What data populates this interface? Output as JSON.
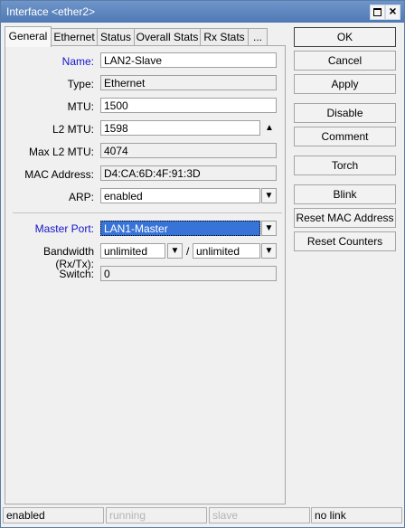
{
  "window": {
    "title": "Interface <ether2>"
  },
  "tabs": [
    "General",
    "Ethernet",
    "Status",
    "Overall Stats",
    "Rx Stats",
    "..."
  ],
  "form": {
    "name": {
      "label": "Name:",
      "value": "LAN2-Slave"
    },
    "type": {
      "label": "Type:",
      "value": "Ethernet"
    },
    "mtu": {
      "label": "MTU:",
      "value": "1500"
    },
    "l2mtu": {
      "label": "L2 MTU:",
      "value": "1598"
    },
    "max_l2mtu": {
      "label": "Max L2 MTU:",
      "value": "4074"
    },
    "mac": {
      "label": "MAC Address:",
      "value": "D4:CA:6D:4F:91:3D"
    },
    "arp": {
      "label": "ARP:",
      "value": "enabled"
    },
    "master_port": {
      "label": "Master Port:",
      "value": "LAN1-Master"
    },
    "bandwidth": {
      "label": "Bandwidth (Rx/Tx):",
      "rx": "unlimited",
      "tx": "unlimited",
      "separator": "/"
    },
    "switch": {
      "label": "Switch:",
      "value": "0"
    }
  },
  "buttons": {
    "ok": "OK",
    "cancel": "Cancel",
    "apply": "Apply",
    "disable": "Disable",
    "comment": "Comment",
    "torch": "Torch",
    "blink": "Blink",
    "reset_mac": "Reset MAC Address",
    "reset_counters": "Reset Counters"
  },
  "statusbar": [
    "enabled",
    "running",
    "slave",
    "no link"
  ],
  "colors": {
    "title_bar": "#4f79b5",
    "selection": "#3874d8",
    "highlight_label": "#1414c8"
  },
  "icons": [
    "maximize-icon",
    "close-icon",
    "dropdown-arrow-icon",
    "collapse-up-icon"
  ]
}
